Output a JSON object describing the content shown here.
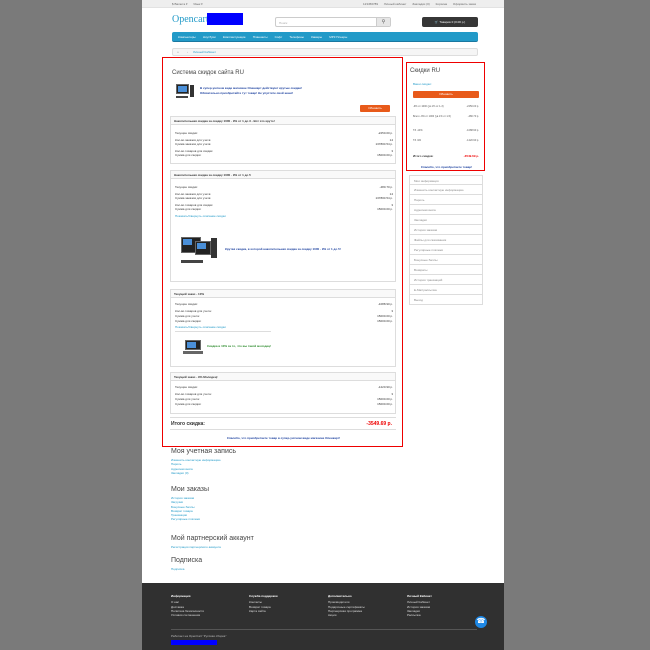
{
  "topbar": {
    "currency": "$ Валюта ▾",
    "language": "Язык ▾",
    "phone": "123456789",
    "account": "Личный кабинет",
    "wishlist": "Закладки (0)",
    "cart": "Корзина",
    "checkout": "Оформить заказ"
  },
  "header": {
    "logo": "Opencart",
    "search_placeholder": "Поиск",
    "search_icon": "magnifier",
    "cart_label": "Товаров 0 (0.00 р.)"
  },
  "menu": [
    "Компьютеры",
    "Ноутбуки",
    "Комплектующие",
    "Планшеты",
    "Софт",
    "Телефоны",
    "Камеры",
    "MP3 Плееры"
  ],
  "breadcrumb": {
    "home_icon": "home",
    "item": "Личный Кабинет"
  },
  "main": {
    "title": "Система скидок сайта RU",
    "promo1_line1": "В супер-уютном виде магазине Опенкарт действуют крутые скидки!",
    "promo1_line2": "Обязательно приобретайте тут товар! Не упустите свой шанс!",
    "button_label": "Обновить",
    "panel1": {
      "header": "Накопительная скидка за скидку 1000 - 9% от 1 до 3 - Вот это круто!",
      "rows": [
        {
          "label": "Текущие скидки:",
          "value": "-2250.00 р."
        },
        {
          "label": "Кол-во заказов для учета:",
          "value": "14"
        },
        {
          "label": "Сумма заказов для учета:",
          "value": "137800.54 р."
        },
        {
          "label": "Кол-во товаров для скидки:",
          "value": "3"
        },
        {
          "label": "Сумма для скидки:",
          "value": "15000.00 р."
        }
      ]
    },
    "panel2": {
      "header": "Накопительная скидка за скидку 1000 - 9% от 1 до 5",
      "rows": [
        {
          "label": "Текущие скидки:",
          "value": "-480.70 р."
        },
        {
          "label": "Кол-во заказов для учета:",
          "value": "14"
        },
        {
          "label": "Сумма заказов для учета:",
          "value": "137800.54 р."
        },
        {
          "label": "Кол-во товаров для скидки:",
          "value": "3"
        },
        {
          "label": "Сумма для скидки:",
          "value": "15000.00 р."
        }
      ],
      "link": "Показать/Свернуть описание скидки",
      "promo": "Крутая скидка, в которой накопительная скидка за скидку 1000 - 9% от 1 до 5!"
    },
    "panel3": {
      "header": "Текущий заказ - 10%",
      "rows": [
        {
          "label": "Текущие скидки:",
          "value": "-1088.90 р."
        },
        {
          "label": "Кол-во товаров для учета:",
          "value": "3"
        },
        {
          "label": "Сумма для учета:",
          "value": "15000.00 р."
        },
        {
          "label": "Сумма для скидки:",
          "value": "15000.00 р."
        }
      ],
      "link": "Показать/Свернуть описание скидки",
      "promo": "Скидка в 10% за то, что вы такой молодец!"
    },
    "panel4": {
      "header": "Текущий заказ - 9% Молодец!",
      "rows": [
        {
          "label": "Текущие скидки:",
          "value": "-1220.90 р."
        },
        {
          "label": "Кол-во товаров для учета:",
          "value": "3"
        },
        {
          "label": "Сумма для учета:",
          "value": "15000.00 р."
        },
        {
          "label": "Сумма для скидки:",
          "value": "15000.00 р."
        }
      ]
    },
    "total_label": "Итого скидка:",
    "total_value": "-3549.69 р.",
    "thanks": "Спасибо, что приобретаете товар в супер-уютном виде магазине Опенкарт!"
  },
  "sidebar": {
    "title": "Скидки RU",
    "label": "Ваши скидки:",
    "button": "Обновить",
    "rows": [
      {
        "label": "-9% от 1000 (ув.1% от 1-3)",
        "value": "-2250.00 р."
      },
      {
        "label": "Всего -9% от 1000 (ув.1% от 1-5)",
        "value": "-480.70 р."
      },
      {
        "label": "ТЗ -10%",
        "value": "-1088.90 р."
      },
      {
        "label": "ТЗ -9%",
        "value": "-1220.90 р."
      }
    ],
    "total_label": "Итого скидка:",
    "total_value": "-3549.69 р.",
    "thanks": "Спасибо, что приобретаете товар!"
  },
  "account_menu": [
    "Мои информация",
    "Изменить контактную информацию",
    "Пароль",
    "Адресная книга",
    "Закладки",
    "История заказов",
    "Файлы для скачивания",
    "Регулярные платежи",
    "Бонусные баллы",
    "Возвраты",
    "История транзакций",
    "E-Mail рассылка",
    "Выход"
  ],
  "sections": [
    {
      "title": "Моя учетная запись",
      "links": [
        "Изменить контактную информацию",
        "Пароль",
        "Адресная книга",
        "Закладки (0)"
      ]
    },
    {
      "title": "Мои заказы",
      "links": [
        "История заказов",
        "Загрузки",
        "Бонусные баллы",
        "Возврат товара",
        "Транзакции",
        "Регулярные платежи"
      ]
    },
    {
      "title": "Мой партнерский аккаунт",
      "links": [
        "Регистрация партнерского аккаунта"
      ]
    },
    {
      "title": "Подписка",
      "links": [
        "Подписка"
      ]
    }
  ],
  "footer": {
    "cols": [
      {
        "title": "Информация",
        "links": [
          "О нас",
          "Доставка",
          "Политика безопасности",
          "Условия соглашения"
        ]
      },
      {
        "title": "Служба поддержки",
        "links": [
          "Контакты",
          "Возврат товара",
          "Карта сайта"
        ]
      },
      {
        "title": "Дополнительно",
        "links": [
          "Производители",
          "Подарочные сертификаты",
          "Партнерская программа",
          "Акции"
        ]
      },
      {
        "title": "Личный Кабинет",
        "links": [
          "Личный Кабинет",
          "История заказов",
          "Закладки",
          "Рассылка"
        ]
      }
    ],
    "powered": "Работает на OpenCart \"Русская сборка\"",
    "phone_icon": "phone"
  }
}
